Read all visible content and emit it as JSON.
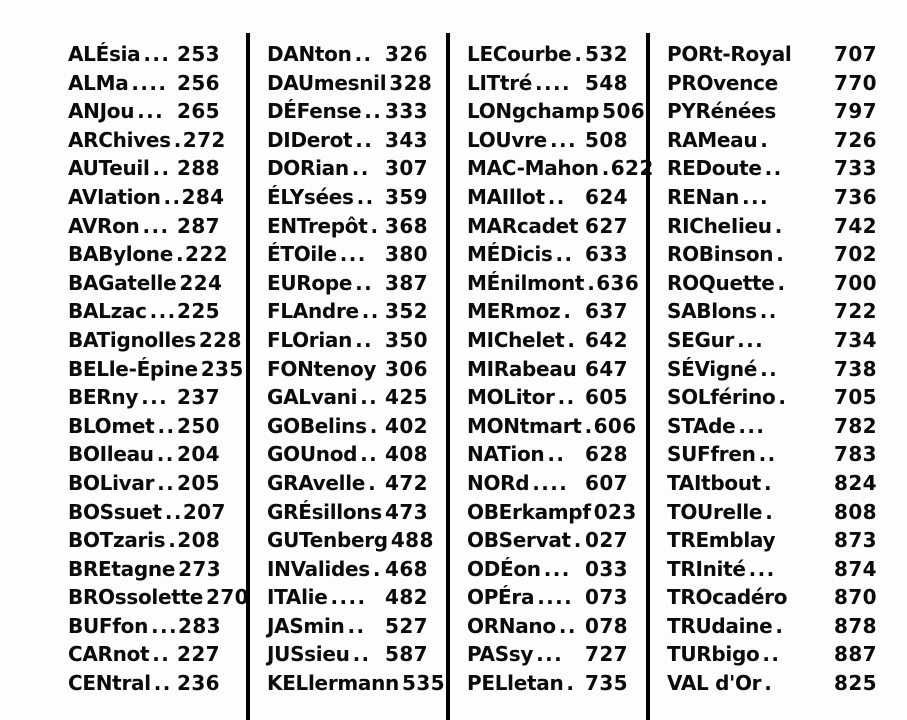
{
  "page": {
    "kind": "telephone-exchange-index",
    "language": "fr",
    "column_count": 4,
    "divider_color": "#000000",
    "text_color": "#0b0b0b",
    "background_color": "#fdfdfd"
  },
  "columns": [
    {
      "index": 0,
      "entries": [
        {
          "name": "ALÉsia",
          "dots": "...",
          "code": "253"
        },
        {
          "name": "ALMa",
          "dots": "....",
          "code": "256"
        },
        {
          "name": "ANJou",
          "dots": "...",
          "code": "265"
        },
        {
          "name": "ARChives",
          "dots": ".",
          "code": "272"
        },
        {
          "name": "AUTeuil",
          "dots": "..",
          "code": "288"
        },
        {
          "name": "AVIation",
          "dots": "..",
          "code": "284"
        },
        {
          "name": "AVRon",
          "dots": "...",
          "code": "287"
        },
        {
          "name": "BABylone",
          "dots": ".",
          "code": "222"
        },
        {
          "name": "BAGatelle",
          "dots": "",
          "code": "224"
        },
        {
          "name": "BALzac",
          "dots": "...",
          "code": "225"
        },
        {
          "name": "BATignolles",
          "dots": "",
          "code": "228"
        },
        {
          "name": "BELle-Épine",
          "dots": "",
          "code": "235"
        },
        {
          "name": "BERny",
          "dots": "...",
          "code": "237"
        },
        {
          "name": "BLOmet",
          "dots": "..",
          "code": "250"
        },
        {
          "name": "BOIleau",
          "dots": "..",
          "code": "204"
        },
        {
          "name": "BOLivar",
          "dots": "..",
          "code": "205"
        },
        {
          "name": "BOSsuet",
          "dots": "..",
          "code": "207"
        },
        {
          "name": "BOTzaris",
          "dots": ".",
          "code": "208"
        },
        {
          "name": "BREtagne",
          "dots": "",
          "code": "273"
        },
        {
          "name": "BROssolette",
          "dots": "",
          "code": "270"
        },
        {
          "name": "BUFfon",
          "dots": "...",
          "code": "283"
        },
        {
          "name": "CARnot",
          "dots": "..",
          "code": "227"
        },
        {
          "name": "CENtral",
          "dots": "..",
          "code": "236"
        }
      ]
    },
    {
      "index": 1,
      "entries": [
        {
          "name": "DANton",
          "dots": "..",
          "code": "326"
        },
        {
          "name": "DAUmesnil",
          "dots": "",
          "code": "328"
        },
        {
          "name": "DÉFense",
          "dots": "..",
          "code": "333"
        },
        {
          "name": "DIDerot",
          "dots": "..",
          "code": "343"
        },
        {
          "name": "DORian",
          "dots": "..",
          "code": "307"
        },
        {
          "name": "ÉLYsées",
          "dots": "..",
          "code": "359"
        },
        {
          "name": "ENTrepôt",
          "dots": ".",
          "code": "368"
        },
        {
          "name": "ÉTOile",
          "dots": "...",
          "code": "380"
        },
        {
          "name": "EURope",
          "dots": "..",
          "code": "387"
        },
        {
          "name": "FLAndre",
          "dots": "..",
          "code": "352"
        },
        {
          "name": "FLOrian",
          "dots": "..",
          "code": "350"
        },
        {
          "name": "FONtenoy",
          "dots": "",
          "code": "306"
        },
        {
          "name": "GALvani",
          "dots": "..",
          "code": "425"
        },
        {
          "name": "GOBelins",
          "dots": ".",
          "code": "402"
        },
        {
          "name": "GOUnod",
          "dots": "..",
          "code": "408"
        },
        {
          "name": "GRAvelle",
          "dots": ".",
          "code": "472"
        },
        {
          "name": "GRÉsillons",
          "dots": "",
          "code": "473"
        },
        {
          "name": "GUTenberg",
          "dots": "",
          "code": "488"
        },
        {
          "name": "INValides",
          "dots": ".",
          "code": "468"
        },
        {
          "name": "ITAlie",
          "dots": "....",
          "code": "482"
        },
        {
          "name": "JASmin",
          "dots": "..",
          "code": "527"
        },
        {
          "name": "JUSsieu",
          "dots": "..",
          "code": "587"
        },
        {
          "name": "KELlermann",
          "dots": "",
          "code": "535"
        }
      ]
    },
    {
      "index": 2,
      "entries": [
        {
          "name": "LECourbe",
          "dots": ".",
          "code": "532"
        },
        {
          "name": "LITtré",
          "dots": "....",
          "code": "548"
        },
        {
          "name": "LONgchamp",
          "dots": "",
          "code": "506"
        },
        {
          "name": "LOUvre",
          "dots": "...",
          "code": "508"
        },
        {
          "name": "MAC-Mahon",
          "dots": ".",
          "code": "622"
        },
        {
          "name": "MAIllot",
          "dots": "..",
          "code": "624"
        },
        {
          "name": "MARcadet",
          "dots": "",
          "code": "627"
        },
        {
          "name": "MÉDicis",
          "dots": "..",
          "code": "633"
        },
        {
          "name": "MÉnilmont",
          "dots": ".",
          "code": "636"
        },
        {
          "name": "MERmoz",
          "dots": ".",
          "code": "637"
        },
        {
          "name": "MIChelet",
          "dots": ".",
          "code": "642"
        },
        {
          "name": "MIRabeau",
          "dots": "",
          "code": "647"
        },
        {
          "name": "MOLitor",
          "dots": "..",
          "code": "605"
        },
        {
          "name": "MONtmart",
          "dots": ".",
          "code": "606"
        },
        {
          "name": "NATion",
          "dots": "..",
          "code": "628"
        },
        {
          "name": "NORd",
          "dots": "....",
          "code": "607"
        },
        {
          "name": "OBErkampf",
          "dots": "",
          "code": "023"
        },
        {
          "name": "OBServat",
          "dots": ".",
          "code": "027"
        },
        {
          "name": "ODÉon",
          "dots": "...",
          "code": "033"
        },
        {
          "name": "OPÉra",
          "dots": "....",
          "code": "073"
        },
        {
          "name": "ORNano",
          "dots": "..",
          "code": "078"
        },
        {
          "name": "PASsy",
          "dots": "...",
          "code": "727"
        },
        {
          "name": "PELletan",
          "dots": ".",
          "code": "735"
        }
      ]
    },
    {
      "index": 3,
      "entries": [
        {
          "name": "PORt-Royal",
          "dots": "",
          "code": "707"
        },
        {
          "name": "PROvence",
          "dots": "",
          "code": "770"
        },
        {
          "name": "PYRénées",
          "dots": "",
          "code": "797"
        },
        {
          "name": "RAMeau",
          "dots": ".",
          "code": "726"
        },
        {
          "name": "REDoute",
          "dots": "..",
          "code": "733"
        },
        {
          "name": "RENan",
          "dots": "...",
          "code": "736"
        },
        {
          "name": "RICheIieu",
          "dots": ".",
          "code": "742"
        },
        {
          "name": "ROBinson",
          "dots": ".",
          "code": "702"
        },
        {
          "name": "ROQuette",
          "dots": ".",
          "code": "700"
        },
        {
          "name": "SABlons",
          "dots": "..",
          "code": "722"
        },
        {
          "name": "SEGur",
          "dots": "...",
          "code": "734"
        },
        {
          "name": "SÉVigné",
          "dots": "..",
          "code": "738"
        },
        {
          "name": "SOLférino",
          "dots": ".",
          "code": "705"
        },
        {
          "name": "STAde",
          "dots": "...",
          "code": "782"
        },
        {
          "name": "SUFfren",
          "dots": "..",
          "code": "783"
        },
        {
          "name": "TAItbout",
          "dots": ".",
          "code": "824"
        },
        {
          "name": "TOUrelle",
          "dots": ".",
          "code": "808"
        },
        {
          "name": "TREmblay",
          "dots": "",
          "code": "873"
        },
        {
          "name": "TRInité",
          "dots": "...",
          "code": "874"
        },
        {
          "name": "TROcadéro",
          "dots": "",
          "code": "870"
        },
        {
          "name": "TRUdaine",
          "dots": ".",
          "code": "878"
        },
        {
          "name": "TURbigo",
          "dots": "..",
          "code": "887"
        },
        {
          "name": "VAL d'Or",
          "dots": ".",
          "code": "825"
        }
      ]
    }
  ]
}
